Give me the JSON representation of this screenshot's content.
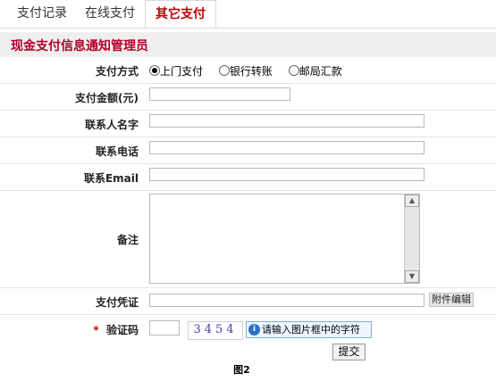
{
  "tabs": [
    {
      "label": "支付记录",
      "active": false
    },
    {
      "label": "在线支付",
      "active": false
    },
    {
      "label": "其它支付",
      "active": true
    }
  ],
  "section_title": "现金支付信息通知管理员",
  "form": {
    "payment_method": {
      "label": "支付方式",
      "options": [
        "上门支付",
        "银行转账",
        "邮局汇款"
      ],
      "selected": "上门支付"
    },
    "amount": {
      "label": "支付金额(元)",
      "value": ""
    },
    "contact_name": {
      "label": "联系人名字",
      "value": ""
    },
    "phone": {
      "label": "联系电话",
      "value": ""
    },
    "email": {
      "label": "联系Email",
      "value": ""
    },
    "remarks": {
      "label": "备注",
      "value": ""
    },
    "voucher": {
      "label": "支付凭证",
      "value": "",
      "button": "附件编辑"
    },
    "captcha": {
      "required_mark": "*",
      "label": "验证码",
      "value": "",
      "image_text": "3454",
      "hint": "请输入图片框中的字符"
    },
    "submit_label": "提交"
  },
  "caption": "图2",
  "colors": {
    "accent": "#b0002a",
    "active_tab_text": "#c00000",
    "section_bg": "#efefef",
    "hint_border": "#7db0e0",
    "hint_bg": "#eef6ff"
  },
  "icons": {
    "captcha_hint": "info-icon"
  }
}
